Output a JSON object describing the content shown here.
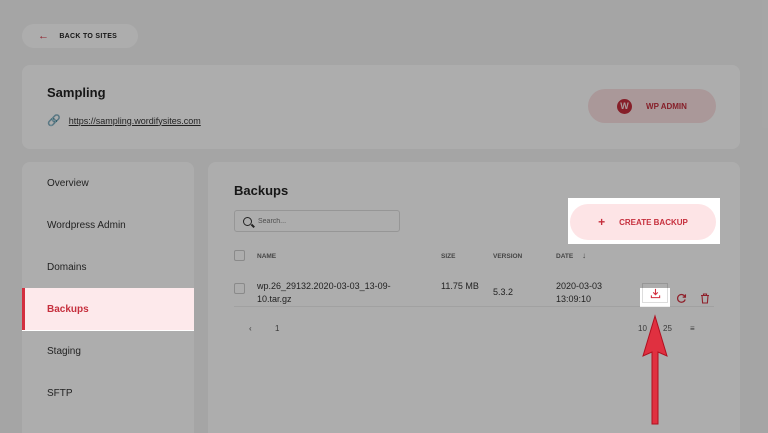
{
  "back_button": {
    "label": "BACK TO SITES"
  },
  "site": {
    "title": "Sampling",
    "url": "https://sampling.wordifysites.com",
    "wp_admin_label": "WP ADMIN"
  },
  "sidebar": {
    "items": [
      {
        "label": "Overview"
      },
      {
        "label": "Wordpress Admin"
      },
      {
        "label": "Domains"
      },
      {
        "label": "Backups"
      },
      {
        "label": "Staging"
      },
      {
        "label": "SFTP"
      }
    ],
    "active": "Backups"
  },
  "backups": {
    "title": "Backups",
    "search_placeholder": "Search...",
    "create_label": "CREATE BACKUP",
    "columns": {
      "name": "NAME",
      "size": "SIZE",
      "version": "VERSION",
      "date": "DATE"
    },
    "rows": [
      {
        "name": "wp.26_29132.2020-03-03_13-09-10.tar.gz",
        "size": "11.75 MB",
        "version": "5.3.2",
        "date": "2020-03-03 13:09:10"
      }
    ],
    "pagination": {
      "prev": "‹",
      "page": "1",
      "per_page_a": "10",
      "per_page_b": "25",
      "menu": "≡"
    }
  },
  "colors": {
    "accent": "#d32f3f",
    "accent_light": "#fde4e6",
    "arrow": "#e03040"
  },
  "icons": [
    "back-arrow-icon",
    "link-icon",
    "wordpress-icon",
    "search-icon",
    "plus-icon",
    "download-icon",
    "restore-icon",
    "trash-icon",
    "sort-arrow-icon"
  ]
}
